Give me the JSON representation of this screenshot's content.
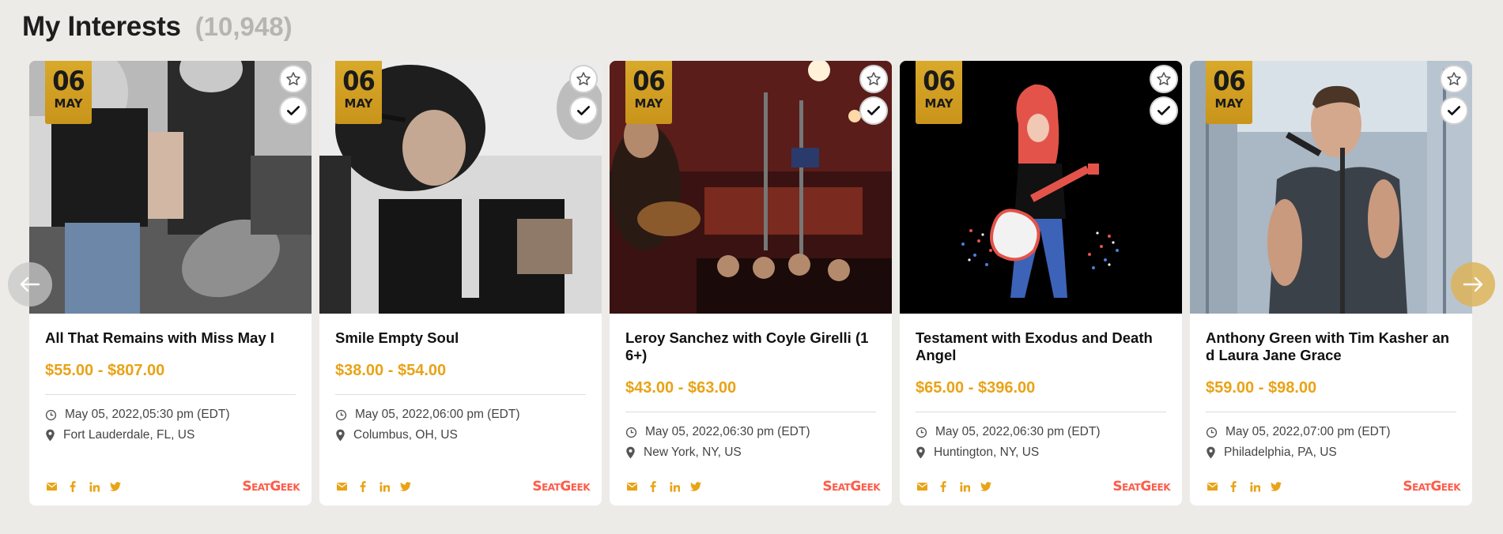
{
  "header": {
    "title": "My Interests",
    "count": "(10,948)"
  },
  "colors": {
    "accent": "#e8a317",
    "badge": "#d4a227",
    "brand": "#ff5b49",
    "background": "#ecebe8"
  },
  "icons": {
    "favorite": "star-icon",
    "interested": "check-icon",
    "time": "clock-icon",
    "location": "map-pin-icon",
    "share": [
      "email-icon",
      "facebook-icon",
      "linkedin-icon",
      "twitter-icon"
    ],
    "prev": "arrow-left-icon",
    "next": "arrow-right-icon"
  },
  "cards": [
    {
      "day": "06",
      "month": "MAY",
      "title": "All That Remains with Miss May I",
      "price": "$55.00 - $807.00",
      "datetime": "May 05, 2022,05:30 pm (EDT)",
      "location": "Fort Lauderdale, FL, US",
      "brand": "SeatGeek"
    },
    {
      "day": "06",
      "month": "MAY",
      "title": "Smile Empty Soul",
      "price": "$38.00 - $54.00",
      "datetime": "May 05, 2022,06:00 pm (EDT)",
      "location": "Columbus, OH, US",
      "brand": "SeatGeek"
    },
    {
      "day": "06",
      "month": "MAY",
      "title": "Leroy Sanchez with Coyle Girelli (16+)",
      "price": "$43.00 - $63.00",
      "datetime": "May 05, 2022,06:30 pm (EDT)",
      "location": "New York, NY, US",
      "brand": "SeatGeek"
    },
    {
      "day": "06",
      "month": "MAY",
      "title": "Testament with Exodus and Death Angel",
      "price": "$65.00 - $396.00",
      "datetime": "May 05, 2022,06:30 pm (EDT)",
      "location": "Huntington, NY, US",
      "brand": "SeatGeek"
    },
    {
      "day": "06",
      "month": "MAY",
      "title": "Anthony Green with Tim Kasher and Laura Jane Grace",
      "price": "$59.00 - $98.00",
      "datetime": "May 05, 2022,07:00 pm (EDT)",
      "location": "Philadelphia, PA, US",
      "brand": "SeatGeek"
    }
  ]
}
